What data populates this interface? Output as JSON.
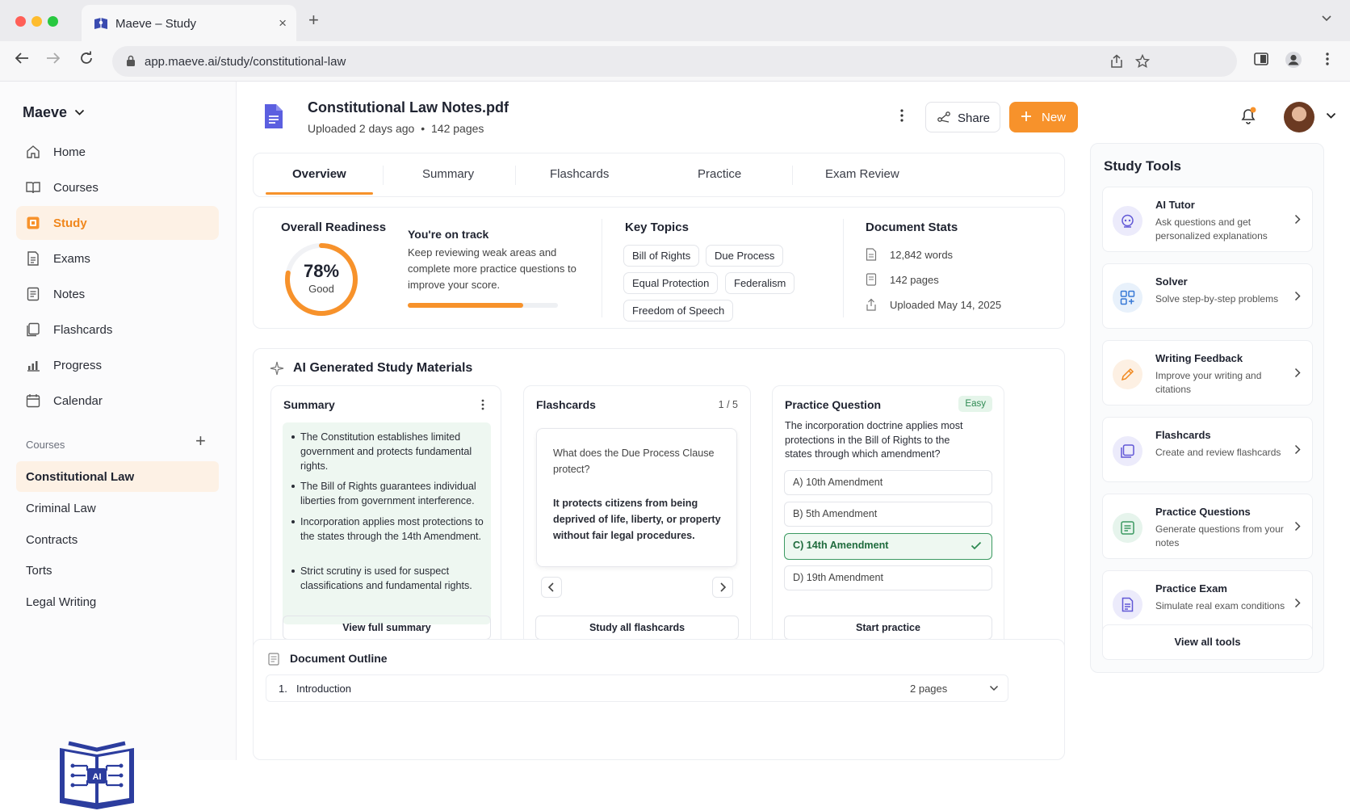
{
  "browser": {
    "tab_title": "Maeve – Study",
    "url": "app.maeve.ai/study/constitutional-law"
  },
  "sidebar": {
    "brand": "Maeve",
    "nav": [
      {
        "label": "Home",
        "icon": "home-icon"
      },
      {
        "label": "Courses",
        "icon": "book-open-icon"
      },
      {
        "label": "Study",
        "icon": "study-icon",
        "active": true
      },
      {
        "label": "Exams",
        "icon": "exam-icon"
      },
      {
        "label": "Notes",
        "icon": "notes-icon"
      },
      {
        "label": "Flashcards",
        "icon": "flashcards-icon"
      },
      {
        "label": "Progress",
        "icon": "chart-icon"
      },
      {
        "label": "Calendar",
        "icon": "calendar-icon"
      }
    ],
    "courses_label": "Courses",
    "courses": [
      "Constitutional Law",
      "Criminal Law",
      "Contracts",
      "Torts",
      "Legal Writing"
    ],
    "logo_text": "AI"
  },
  "header": {
    "doc_title": "Constitutional Law Notes.pdf",
    "uploaded": "Uploaded 2 days ago",
    "separator": "•",
    "pages": "142 pages",
    "share_label": "Share",
    "new_label": "New"
  },
  "tabs": [
    "Overview",
    "Summary",
    "Flashcards",
    "Practice",
    "Exam Review"
  ],
  "overview": {
    "readiness_label": "Overall Readiness",
    "readiness_percent": 78,
    "readiness_value": "78%",
    "readiness_grade": "Good",
    "track_title": "You're on track",
    "track_text": "Keep reviewing weak areas and complete more practice questions to improve your score.",
    "track_progress": 0.77,
    "key_topics_label": "Key Topics",
    "topics": [
      "Bill of Rights",
      "Due Process",
      "Equal Protection",
      "Federalism",
      "Freedom of Speech"
    ],
    "stats_label": "Document Stats",
    "stats": [
      "12,842 words",
      "142 pages",
      "Uploaded May 14, 2025"
    ]
  },
  "materials": {
    "title": "AI Generated Study Materials",
    "summary": {
      "title": "Summary",
      "bullets": [
        "The Constitution establishes limited government and protects fundamental rights.",
        "The Bill of Rights guarantees individual liberties from government interference.",
        "Incorporation applies most protections to the states through the 14th Amendment.",
        "Strict scrutiny is used for suspect classifications and fundamental rights."
      ],
      "button": "View full summary"
    },
    "flashcards": {
      "title": "Flashcards",
      "counter": "1 / 5",
      "question": "What does the Due Process Clause protect?",
      "answer": "It protects citizens from being deprived of life, liberty, or property without fair legal procedures.",
      "button": "Study all flashcards"
    },
    "practice": {
      "title": "Practice Question",
      "difficulty": "Easy",
      "question": "The incorporation doctrine applies most protections in the Bill of Rights to the states through which amendment?",
      "options": [
        "A) 10th Amendment",
        "B) 5th Amendment",
        "C) 14th Amendment",
        "D) 19th Amendment"
      ],
      "correct_index": 2,
      "button": "Start practice"
    }
  },
  "outline": {
    "title": "Document Outline",
    "items": [
      {
        "num": "1.",
        "label": "Introduction",
        "pages": "2 pages"
      }
    ]
  },
  "tools": {
    "title": "Study Tools",
    "items": [
      {
        "title": "AI Tutor",
        "desc": "Ask questions and get personalized explanations",
        "color": "#ecebfb"
      },
      {
        "title": "Solver",
        "desc": "Solve step-by-step problems",
        "color": "#e8f1fb"
      },
      {
        "title": "Writing Feedback",
        "desc": "Improve your writing and citations",
        "color": "#fdf0e3"
      },
      {
        "title": "Flashcards",
        "desc": "Create and review flashcards",
        "color": "#ecebfb"
      },
      {
        "title": "Practice Questions",
        "desc": "Generate questions from your notes",
        "color": "#e6f4ec"
      },
      {
        "title": "Practice Exam",
        "desc": "Simulate real exam conditions",
        "color": "#ecebfb"
      }
    ],
    "view_all": "View all tools"
  },
  "colors": {
    "accent": "#f7922b",
    "success": "#3c9a62",
    "brand_blue": "#2c3d9e"
  }
}
